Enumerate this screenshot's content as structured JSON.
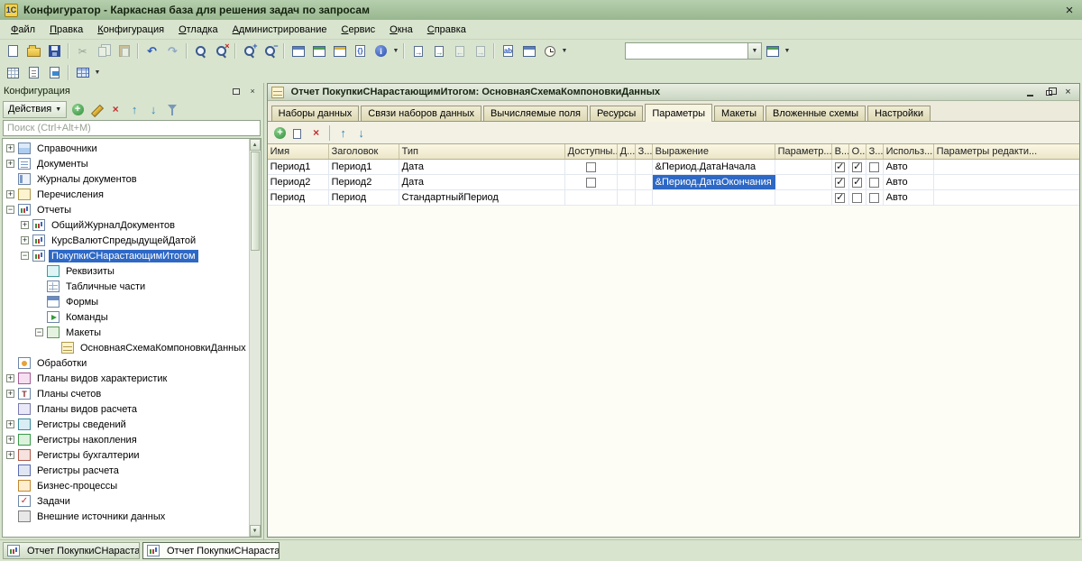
{
  "titlebar": {
    "app_badge": "1С",
    "title": "Конфигуратор - Каркасная база для решения задач по запросам"
  },
  "menubar": {
    "items": [
      "Файл",
      "Правка",
      "Конфигурация",
      "Отладка",
      "Администрирование",
      "Сервис",
      "Окна",
      "Справка"
    ]
  },
  "main_toolbar": {
    "combo_value": "",
    "icons": [
      "new-document",
      "open",
      "save",
      "cut",
      "copy",
      "paste",
      "undo",
      "redo",
      "find",
      "stop-find",
      "zoom-in",
      "zoom-out",
      "configuration",
      "database-configuration",
      "compare-configurations",
      "module-check",
      "info",
      "procedures-list",
      "go-to-definition",
      "navigate-back",
      "navigate-forward",
      "syntax-check",
      "text-templates",
      "timer"
    ]
  },
  "secondary_toolbar": {
    "icons": [
      "new-spreadsheet-document",
      "new-text-document",
      "new-html-document",
      "table"
    ]
  },
  "sidebar": {
    "title": "Конфигурация",
    "actions_label": "Действия",
    "search_placeholder": "Поиск (Ctrl+Alt+M)",
    "tree": [
      {
        "label": "Справочники"
      },
      {
        "label": "Документы"
      },
      {
        "label": "Журналы документов"
      },
      {
        "label": "Перечисления"
      },
      {
        "label": "Отчеты"
      },
      {
        "label": "ОбщийЖурналДокументов"
      },
      {
        "label": "КурсВалютСпредыдущейДатой"
      },
      {
        "label": "ПокупкиСНарастающимИтогом"
      },
      {
        "label": "Реквизиты"
      },
      {
        "label": "Табличные части"
      },
      {
        "label": "Формы"
      },
      {
        "label": "Команды"
      },
      {
        "label": "Макеты"
      },
      {
        "label": "ОсновнаяСхемаКомпоновкиДанных"
      },
      {
        "label": "Обработки"
      },
      {
        "label": "Планы видов характеристик"
      },
      {
        "label": "Планы счетов"
      },
      {
        "label": "Планы видов расчета"
      },
      {
        "label": "Регистры сведений"
      },
      {
        "label": "Регистры накопления"
      },
      {
        "label": "Регистры бухгалтерии"
      },
      {
        "label": "Регистры расчета"
      },
      {
        "label": "Бизнес-процессы"
      },
      {
        "label": "Задачи"
      },
      {
        "label": "Внешние источники данных"
      }
    ],
    "selected_item": "ПокупкиСНарастающимИтогом"
  },
  "doc": {
    "title": "Отчет ПокупкиСНарастающимИтогом: ОсновнаяСхемаКомпоновкиДанных",
    "tabs": [
      "Наборы данных",
      "Связи наборов данных",
      "Вычисляемые поля",
      "Ресурсы",
      "Параметры",
      "Макеты",
      "Вложенные схемы",
      "Настройки"
    ],
    "active_tab": "Параметры",
    "columns": [
      "Имя",
      "Заголовок",
      "Тип",
      "Доступны...",
      "Д...",
      "З...",
      "Выражение",
      "Параметр...",
      "В...",
      "О...",
      "З...",
      "Использ...",
      "Параметры редакти..."
    ],
    "rows": [
      {
        "name": "Период1",
        "title": "Период1",
        "type": "Дата",
        "expr": "&Период.ДатаНачала",
        "use": "Авто"
      },
      {
        "name": "Период2",
        "title": "Период2",
        "type": "Дата",
        "expr": "&Период.ДатаОкончания",
        "use": "Авто"
      },
      {
        "name": "Период",
        "title": "Период",
        "type": "СтандартныйПериод",
        "expr": "",
        "use": "Авто"
      }
    ],
    "selected_cell": "&Период.ДатаОкончания"
  },
  "taskbar": {
    "buttons": [
      "Отчет ПокупкиСНараста...",
      "Отчет ПокупкиСНараста..."
    ]
  }
}
